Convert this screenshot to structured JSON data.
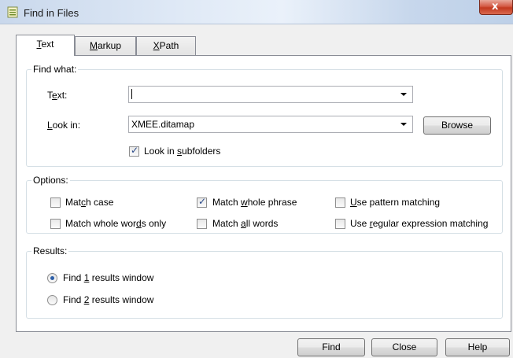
{
  "window": {
    "title": "Find in Files",
    "close_glyph": "x"
  },
  "tabs": [
    {
      "label": "Text",
      "mnemonic": "T",
      "rest": "ext",
      "active": true
    },
    {
      "label": "Markup",
      "mnemonic": "M",
      "rest": "arkup",
      "active": false
    },
    {
      "label": "XPath",
      "mnemonic": "X",
      "rest": "Path",
      "active": false
    }
  ],
  "find_what": {
    "legend": "Find what:",
    "text_label_pre": "T",
    "text_label_mn": "e",
    "text_label_post": "xt:",
    "text_value": "",
    "lookin_label_mn": "L",
    "lookin_label_post": "ook in:",
    "lookin_value": "XMEE.ditamap",
    "browse_label": "Browse",
    "subfolders_pre": "Look in ",
    "subfolders_mn": "s",
    "subfolders_post": "ubfolders",
    "subfolders_checked": true
  },
  "options": {
    "legend": "Options:",
    "match_case_pre": "Mat",
    "match_case_mn": "c",
    "match_case_post": "h case",
    "whole_words_pre": "Match whole wor",
    "whole_words_mn": "d",
    "whole_words_post": "s only",
    "whole_phrase_pre": "Match ",
    "whole_phrase_mn": "w",
    "whole_phrase_post": "hole phrase",
    "all_words_pre": "Match ",
    "all_words_mn": "a",
    "all_words_post": "ll words",
    "pattern_mn": "U",
    "pattern_post": "se pattern matching",
    "regex_pre": "Use ",
    "regex_mn": "r",
    "regex_post": "egular expression matching",
    "checked": {
      "match_case": false,
      "whole_words": false,
      "whole_phrase": true,
      "all_words": false,
      "pattern": false,
      "regex": false
    }
  },
  "results": {
    "legend": "Results:",
    "find1_pre": "Find ",
    "find1_mn": "1",
    "find1_post": " results window",
    "find2_pre": "Find ",
    "find2_mn": "2",
    "find2_post": " results window",
    "selected": "find1"
  },
  "footer": {
    "find_label": "Find",
    "close_label": "Close",
    "help_label": "Help"
  },
  "colors": {
    "radio_dot": "#2d5fa8",
    "check_tick": "#2a4a8a",
    "close_button": "#c2381f"
  },
  "icons": {
    "title": "document-icon",
    "close": "close-icon",
    "dropdown": "chevron-down-icon"
  }
}
